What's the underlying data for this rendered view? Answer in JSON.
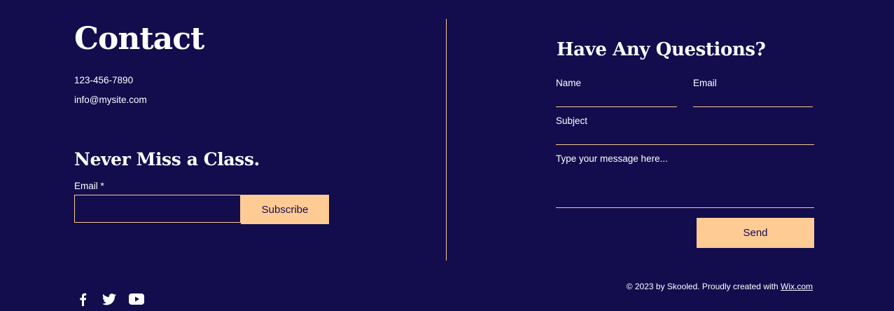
{
  "contact": {
    "title": "Contact",
    "phone": "123-456-7890",
    "email": "info@mysite.com"
  },
  "newsletter": {
    "title": "Never Miss a Class.",
    "email_label": "Email *",
    "email_value": "",
    "subscribe_label": "Subscribe"
  },
  "form": {
    "title": "Have Any Questions?",
    "name_label": "Name",
    "email_label": "Email",
    "subject_label": "Subject",
    "message_placeholder": "Type your message here...",
    "send_label": "Send"
  },
  "footer": {
    "copyright": "© 2023 by Skooled. Proudly created with ",
    "link_text": "Wix.com",
    "social": [
      "facebook-icon",
      "twitter-icon",
      "youtube-icon"
    ]
  },
  "colors": {
    "background": "#130d4e",
    "accent": "#fecb95",
    "text": "#ffffff"
  }
}
